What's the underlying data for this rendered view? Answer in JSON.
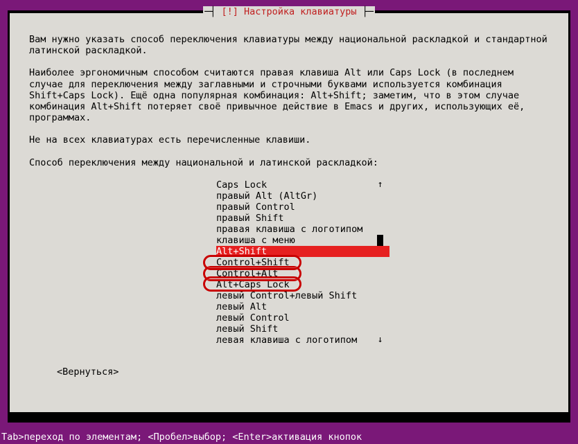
{
  "title": "[!] Настройка клавиатуры",
  "paragraphs": {
    "p1": "Вам нужно указать способ переключения клавиатуры между национальной раскладкой и стандартной латинской раскладкой.",
    "p2": "Наиболее эргономичным способом считаются правая клавиша Alt или Caps Lock (в последнем случае для переключения между заглавными и строчными буквами используется комбинация Shift+Caps Lock). Ещё одна популярная комбинация: Alt+Shift; заметим, что в этом случае комбинация Alt+Shift потеряет своё привычное действие в Emacs и других, использующих её, программах.",
    "p3": "Не на всех клавиатурах есть перечисленные клавиши.",
    "p4": "Способ переключения между национальной и латинской раскладкой:"
  },
  "options": [
    "Caps Lock",
    "правый Alt (AltGr)",
    "правый Control",
    "правый Shift",
    "правая клавиша с логотипом",
    "клавиша с меню",
    "Alt+Shift",
    "Control+Shift",
    "Control+Alt",
    "Alt+Caps Lock",
    "левый Control+левый Shift",
    "левый Alt",
    "левый Control",
    "левый Shift",
    "левая клавиша с логотипом"
  ],
  "selected_index": 6,
  "scroll": {
    "up": "↑",
    "down": "↓"
  },
  "back_label": "<Вернуться>",
  "footer": "Tab>переход по элементам; <Пробел>выбор; <Enter>активация кнопок"
}
